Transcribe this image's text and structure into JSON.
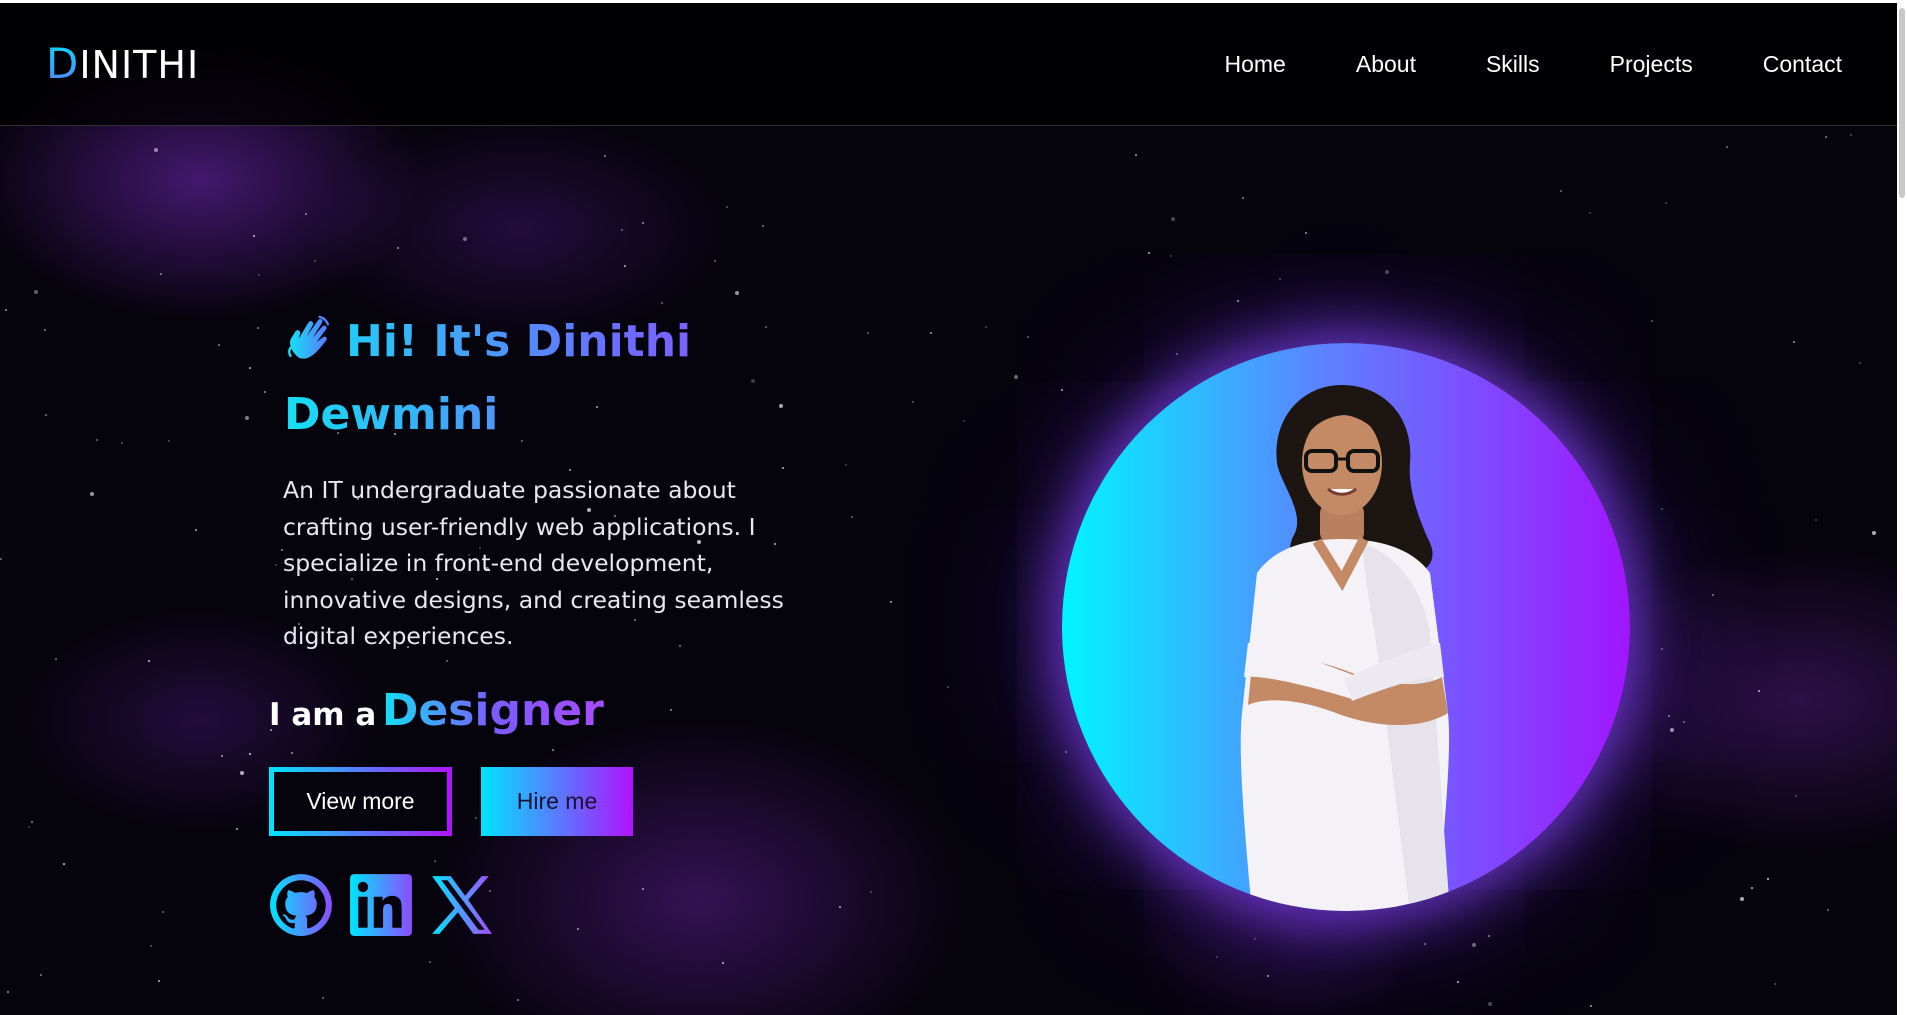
{
  "nav": {
    "logo_first": "D",
    "logo_rest": "INITHI",
    "links": [
      "Home",
      "About",
      "Skills",
      "Projects",
      "Contact"
    ]
  },
  "hero": {
    "greeting": "Hi! It's Dinithi Dewmini",
    "bio": "An IT undergraduate passionate about crafting user-friendly web applications. I specialize in front-end development, innovative designs, and creating seamless digital experiences.",
    "role_prefix": "I am a",
    "role_word": "Designer",
    "view_more_label": "View more",
    "hire_me_label": "Hire me"
  },
  "socials": [
    {
      "icon": "github-icon"
    },
    {
      "icon": "linkedin-icon"
    },
    {
      "icon": "x-icon"
    }
  ],
  "portrait": {
    "icon": "profile-photo"
  },
  "colors": {
    "accent_cyan": "#00e5ff",
    "accent_purple": "#b012ff",
    "background": "#05030c"
  }
}
